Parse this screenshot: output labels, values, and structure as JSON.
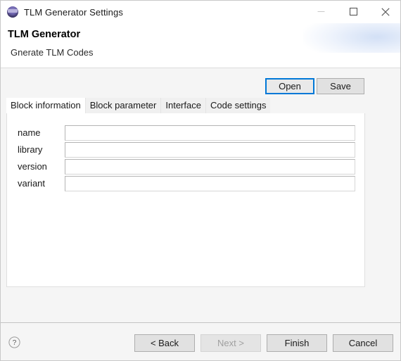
{
  "window": {
    "title": "TLM Generator Settings",
    "icon": "tlm-app-icon",
    "controls": {
      "minimize": "minimize-icon",
      "maximize": "maximize-icon",
      "close": "close-icon"
    }
  },
  "header": {
    "title": "TLM Generator",
    "subtitle": "Gnerate TLM Codes"
  },
  "filebar": {
    "open_label": "Open",
    "save_label": "Save"
  },
  "tabs": [
    {
      "label": "Block information",
      "active": true
    },
    {
      "label": "Block parameter",
      "active": false
    },
    {
      "label": "Interface",
      "active": false
    },
    {
      "label": "Code settings",
      "active": false
    }
  ],
  "form": {
    "fields": [
      {
        "label": "name",
        "value": "",
        "placeholder": ""
      },
      {
        "label": "library",
        "value": "",
        "placeholder": ""
      },
      {
        "label": "version",
        "value": "",
        "placeholder": ""
      },
      {
        "label": "variant",
        "value": "",
        "placeholder": ""
      }
    ]
  },
  "footer": {
    "help_icon": "help-question-icon",
    "buttons": [
      {
        "label": "< Back",
        "disabled": false
      },
      {
        "label": "Next >",
        "disabled": true
      },
      {
        "label": "Finish",
        "disabled": false
      },
      {
        "label": "Cancel",
        "disabled": false
      }
    ]
  },
  "colors": {
    "accent": "#0078d7",
    "window_bg": "#f5f5f5",
    "panel_bg": "#ffffff",
    "border": "#adadad"
  }
}
